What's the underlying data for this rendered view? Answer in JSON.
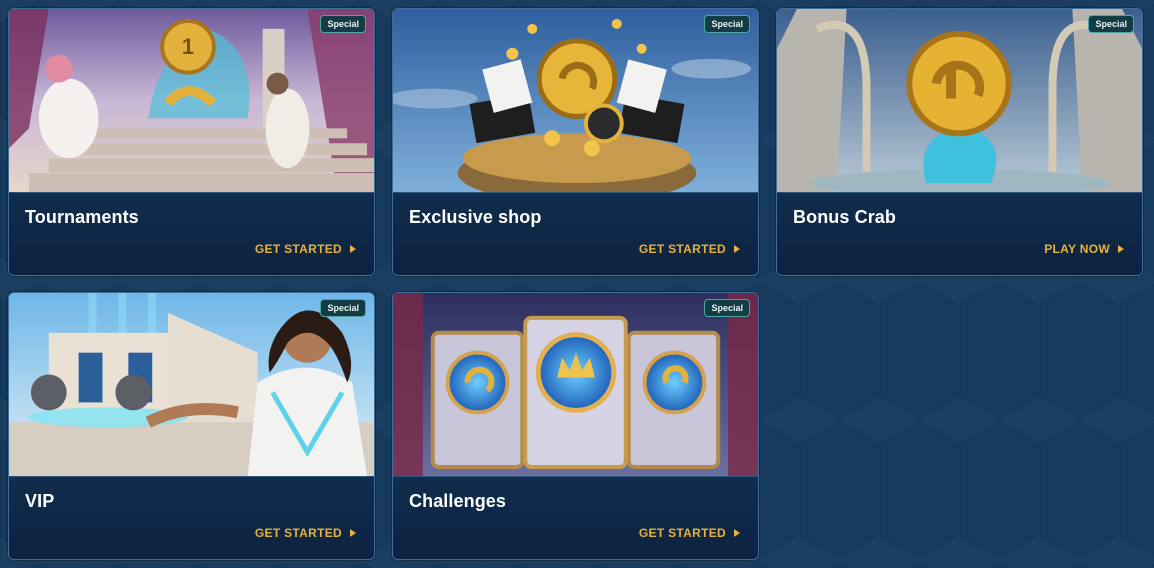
{
  "colors": {
    "background": "#17395c",
    "card_footer": "#0e2644",
    "cta": "#e8b13a",
    "badge_border": "#4fa7a4"
  },
  "cards": [
    {
      "title": "Tournaments",
      "cta": "GET STARTED",
      "badge": "Special",
      "art": "tournaments-artwork"
    },
    {
      "title": "Exclusive shop",
      "cta": "GET STARTED",
      "badge": "Special",
      "art": "exclusive-shop-artwork"
    },
    {
      "title": "Bonus Crab",
      "cta": "PLAY NOW",
      "badge": "Special",
      "art": "bonus-crab-artwork"
    },
    {
      "title": "VIP",
      "cta": "GET STARTED",
      "badge": "Special",
      "art": "vip-artwork"
    },
    {
      "title": "Challenges",
      "cta": "GET STARTED",
      "badge": "Special",
      "art": "challenges-artwork"
    }
  ]
}
